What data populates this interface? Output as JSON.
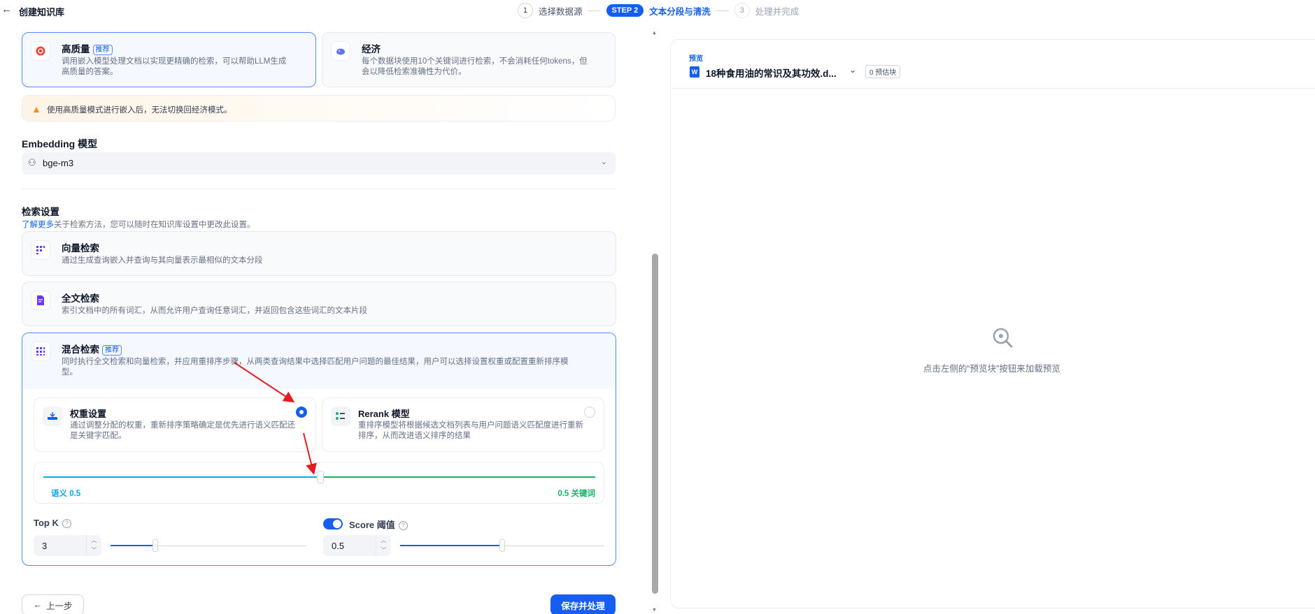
{
  "header": {
    "title": "创建知识库",
    "steps": [
      {
        "num": "1",
        "label": "选择数据源"
      },
      {
        "num": "STEP 2",
        "label": "文本分段与清洗"
      },
      {
        "num": "3",
        "label": "处理并完成"
      }
    ]
  },
  "index_modes": {
    "high_quality": {
      "title": "高质量",
      "badge": "推荐",
      "desc_1": "调用嵌入模型处理文档以实现更精确的检索，可以帮助LLM生成",
      "desc_2": "高质量的答案。"
    },
    "economy": {
      "title": "经济",
      "desc_1": "每个数据块使用10个关键词进行检索，不会消耗任何tokens，但",
      "desc_2": "会以降低检索准确性为代价。"
    }
  },
  "warning": "使用高质量模式进行嵌入后，无法切换回经济模式。",
  "embedding": {
    "label": "Embedding 模型",
    "value": "bge-m3"
  },
  "retrieval": {
    "title": "检索设置",
    "learn_more": "了解更多",
    "learn_desc": "关于检索方法，您可以随时在知识库设置中更改此设置。",
    "vector": {
      "title": "向量检索",
      "desc": "通过生成查询嵌入并查询与其向量表示最相似的文本分段"
    },
    "fulltext": {
      "title": "全文检索",
      "desc": "索引文档中的所有词汇，从而允许用户查询任意词汇，并返回包含这些词汇的文本片段"
    },
    "hybrid": {
      "title": "混合检索",
      "badge": "推荐",
      "desc_1": "同时执行全文检索和向量检索，并应用重排序步骤，从两类查询结果中选择匹配用户问题的最佳结果，用户可以选择设置权重或配置重新排序模",
      "desc_2": "型。",
      "weight": {
        "title": "权重设置",
        "desc_1": "通过调整分配的权重，重新排序策略确定是优先进行语义匹配还",
        "desc_2": "是关键字匹配。",
        "selected": true
      },
      "rerank": {
        "title": "Rerank 模型",
        "desc_1": "重排序模型将根据候选文档列表与用户问题语义匹配度进行重新",
        "desc_2": "排序，从而改进语义排序的结果",
        "selected": false
      },
      "semantic_label": "语义 0.5",
      "keyword_label": "0.5 关键词",
      "semantic_weight": 0.5,
      "top_k": {
        "label": "Top K",
        "value": "3",
        "fraction": 0.23
      },
      "score": {
        "label": "Score 阈值",
        "value": "0.5",
        "enabled": true,
        "fraction": 0.5
      }
    }
  },
  "buttons": {
    "prev": "上一步",
    "save": "保存并处理"
  },
  "preview": {
    "label": "预览",
    "file": "18种食用油的常识及其功效.d...",
    "count": "0 预估块",
    "empty": "点击左侧的“预览块”按钮来加载预览"
  },
  "colors": {
    "accent": "#155eef",
    "semantic": "#0ba5ec",
    "keyword": "#16b364",
    "warning": "#f79009"
  },
  "icons": [
    "back-arrow-icon",
    "chip-icon",
    "piggy-icon",
    "warning-icon",
    "model-icon",
    "chevron-down-icon",
    "grid-icon",
    "doc-search-icon",
    "weight-icon",
    "rerank-icon",
    "help-icon",
    "search-empty-icon"
  ]
}
